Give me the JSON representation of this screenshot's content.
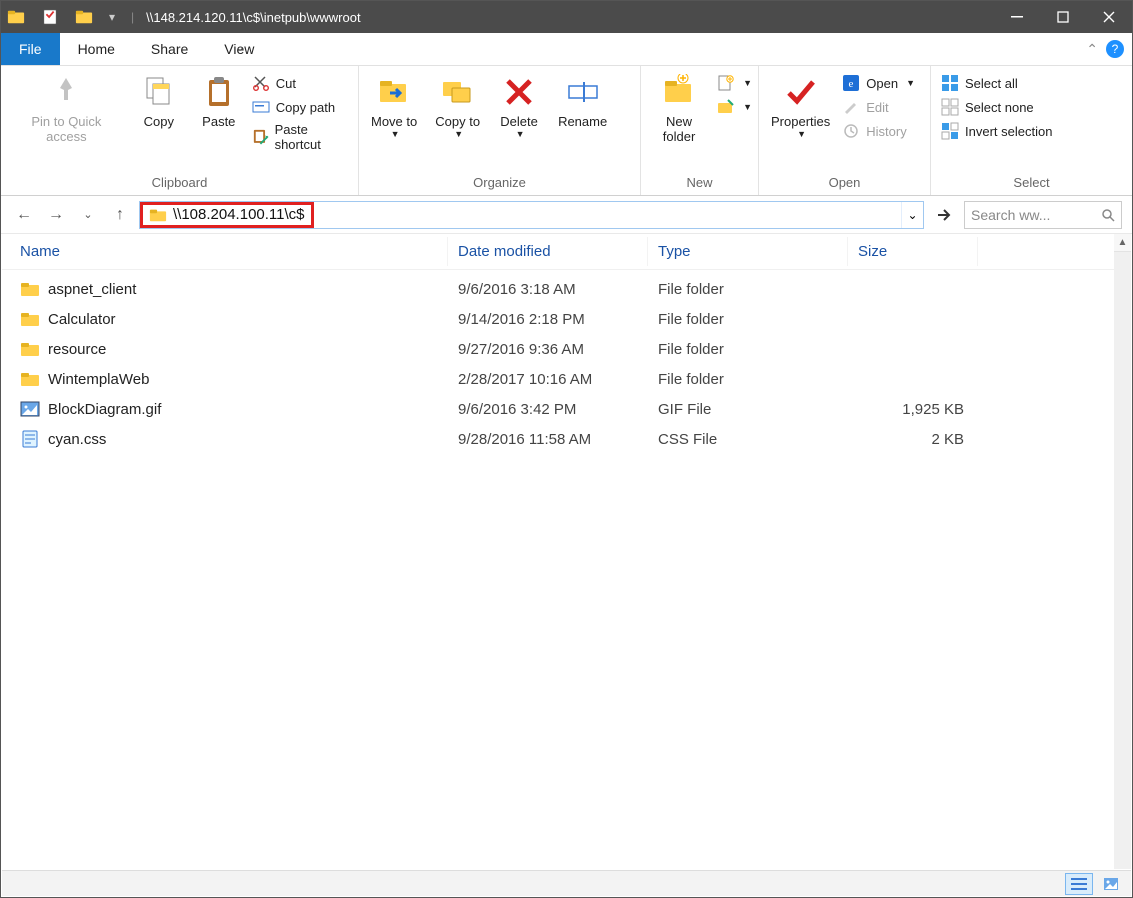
{
  "title": {
    "path": "\\\\148.214.120.11\\c$\\inetpub\\wwwroot"
  },
  "tabs": {
    "file": "File",
    "home": "Home",
    "share": "Share",
    "view": "View"
  },
  "ribbon": {
    "clipboard": {
      "title": "Clipboard",
      "pin": "Pin to Quick access",
      "copy": "Copy",
      "paste": "Paste",
      "cut": "Cut",
      "copy_path": "Copy path",
      "paste_shortcut": "Paste shortcut"
    },
    "organize": {
      "title": "Organize",
      "move_to": "Move to",
      "copy_to": "Copy to",
      "delete": "Delete",
      "rename": "Rename"
    },
    "new": {
      "title": "New",
      "new_folder": "New folder",
      "new_item": "New item",
      "easy_access": "Easy access"
    },
    "open": {
      "title": "Open",
      "properties": "Properties",
      "open": "Open",
      "edit": "Edit",
      "history": "History"
    },
    "select": {
      "title": "Select",
      "select_all": "Select all",
      "select_none": "Select none",
      "invert": "Invert selection"
    }
  },
  "nav": {
    "address_value": "\\\\108.204.100.11\\c$",
    "search_placeholder": "Search ww..."
  },
  "columns": {
    "name": "Name",
    "date": "Date modified",
    "type": "Type",
    "size": "Size"
  },
  "rows": [
    {
      "icon": "folder",
      "name": "aspnet_client",
      "date": "9/6/2016 3:18 AM",
      "type": "File folder",
      "size": ""
    },
    {
      "icon": "folder",
      "name": "Calculator",
      "date": "9/14/2016 2:18 PM",
      "type": "File folder",
      "size": ""
    },
    {
      "icon": "folder",
      "name": "resource",
      "date": "9/27/2016 9:36 AM",
      "type": "File folder",
      "size": ""
    },
    {
      "icon": "folder",
      "name": "WintemplaWeb",
      "date": "2/28/2017 10:16 AM",
      "type": "File folder",
      "size": ""
    },
    {
      "icon": "gif",
      "name": "BlockDiagram.gif",
      "date": "9/6/2016 3:42 PM",
      "type": "GIF File",
      "size": "1,925 KB"
    },
    {
      "icon": "css",
      "name": "cyan.css",
      "date": "9/28/2016 11:58 AM",
      "type": "CSS File",
      "size": "2 KB"
    }
  ]
}
